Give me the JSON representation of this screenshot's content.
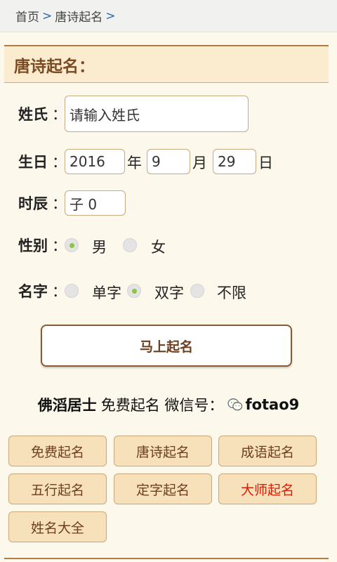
{
  "breadcrumb": {
    "home": "首页",
    "sep1": ">",
    "current": "唐诗起名",
    "sep2": ">"
  },
  "form": {
    "title": "唐诗起名：",
    "surname": {
      "label": "姓氏",
      "colon": "：",
      "placeholder": "请输入姓氏"
    },
    "birthday": {
      "label": "生日",
      "colon": "：",
      "year": "2016",
      "year_unit": "年",
      "month": "9",
      "month_unit": "月",
      "day": "29",
      "day_unit": "日"
    },
    "hour": {
      "label": "时辰",
      "colon": "：",
      "value": "子 0"
    },
    "gender": {
      "label": "性别",
      "colon": "：",
      "options": [
        "男",
        "女"
      ],
      "selected": "男"
    },
    "name_length": {
      "label": "名字",
      "colon": "：",
      "options": [
        "单字",
        "双字",
        "不限"
      ],
      "selected": "单字"
    },
    "submit_label": "马上起名"
  },
  "promo": {
    "brand": "佛滔居士",
    "text": "免费起名 微信号：",
    "wechat_id": "fotao9",
    "icon": "wechat-icon"
  },
  "nav_buttons": [
    {
      "label": "免费起名",
      "color": "#6b3f1f"
    },
    {
      "label": "唐诗起名",
      "color": "#6b3f1f"
    },
    {
      "label": "成语起名",
      "color": "#6b3f1f"
    },
    {
      "label": "五行起名",
      "color": "#6b3f1f"
    },
    {
      "label": "定字起名",
      "color": "#6b3f1f"
    },
    {
      "label": "大师起名",
      "color": "#d81e06"
    },
    {
      "label": "姓名大全",
      "color": "#6b3f1f"
    }
  ],
  "colors": {
    "accent": "#b57b45",
    "radio_checked": "#8cc63f",
    "button_bg": "#f7e1bb"
  }
}
